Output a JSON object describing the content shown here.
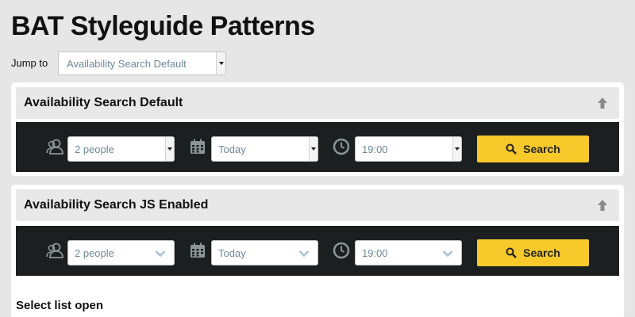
{
  "page": {
    "title": "BAT Styleguide Patterns"
  },
  "jump": {
    "label": "Jump to",
    "selected": "Availability Search Default"
  },
  "sections": [
    {
      "title": "Availability Search Default",
      "people": "2 people",
      "date": "Today",
      "time": "19:00",
      "search_label": "Search"
    },
    {
      "title": "Availability Search JS Enabled",
      "people": "2 people",
      "date": "Today",
      "time": "19:00",
      "search_label": "Search"
    }
  ],
  "select_open_heading": "Select list open",
  "colors": {
    "background": "#e6e6e6",
    "bar": "#1b1f1f",
    "accent_button": "#f7c92b",
    "field_text": "#6e8a99"
  },
  "icons": [
    "people-icon",
    "calendar-icon",
    "clock-icon",
    "search-icon",
    "arrow-up-icon",
    "chevron-down-icon"
  ]
}
